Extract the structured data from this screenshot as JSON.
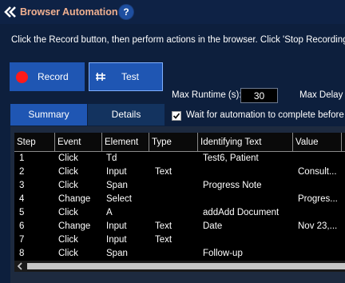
{
  "header": {
    "title": "Browser Automation",
    "back_icon": "double-chevron-left-icon",
    "help_label": "?"
  },
  "instructions": "Click the Record button, then perform actions in the browser. Click 'Stop Recording' in the",
  "buttons": {
    "record_label": "Record",
    "test_label": "Test"
  },
  "settings": {
    "max_runtime_label": "Max Runtime (s):",
    "max_runtime_value": "30",
    "max_delay_label": "Max Delay B",
    "wait_label": "Wait for automation to complete before exe",
    "wait_checked": true
  },
  "tabs": [
    {
      "label": "Summary",
      "active": true
    },
    {
      "label": "Details",
      "active": false
    }
  ],
  "table": {
    "columns": [
      "Step",
      "Event",
      "Element",
      "Type",
      "Identifying Text",
      "Value",
      ""
    ],
    "rows": [
      [
        "1",
        "Click",
        "Td",
        "",
        "Test6, Patient",
        ""
      ],
      [
        "2",
        "Click",
        "Input",
        "Text",
        "",
        "Consult..."
      ],
      [
        "3",
        "Click",
        "Span",
        "",
        "Progress Note",
        ""
      ],
      [
        "4",
        "Change",
        "Select",
        "",
        "",
        "Progres..."
      ],
      [
        "5",
        "Click",
        "A",
        "",
        "addAdd Document",
        ""
      ],
      [
        "6",
        "Change",
        "Input",
        "Text",
        "Date",
        "Nov 23,..."
      ],
      [
        "7",
        "Click",
        "Input",
        "Text",
        "",
        ""
      ],
      [
        "8",
        "Click",
        "Span",
        "",
        "Follow-up",
        ""
      ]
    ]
  },
  "colors": {
    "background": "#0d1f3d",
    "accent_blue": "#1f56b3",
    "title_text": "#f0b090",
    "record_dot": "#ff1a1a"
  }
}
